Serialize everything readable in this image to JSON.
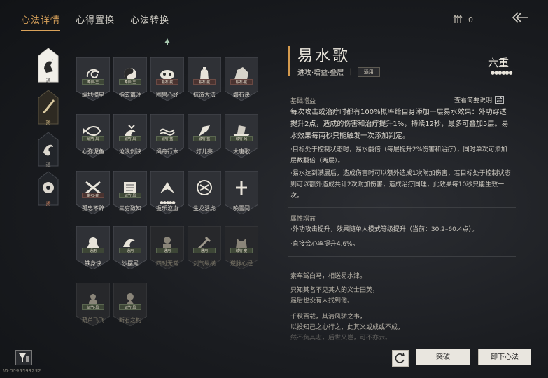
{
  "tabs": [
    {
      "label": "心法详情",
      "active": true
    },
    {
      "label": "心得置换",
      "active": false
    },
    {
      "label": "心法转换",
      "active": false
    }
  ],
  "currency": {
    "value": "0",
    "icon": "arrows-icon"
  },
  "categories": [
    {
      "label": "通",
      "icon": "horse-icon",
      "selected": true
    },
    {
      "label": "扬",
      "icon": "quill-icon"
    },
    {
      "label": "通",
      "icon": "dragon-icon"
    },
    {
      "label": "扬",
      "icon": "wheel-icon"
    }
  ],
  "cards": [
    {
      "name": "纵地摘星",
      "tag": "奉辰·王",
      "tag_style": "green",
      "icon": "swirl-icon"
    },
    {
      "name": "指玄篇注",
      "tag": "奉辰·王",
      "tag_style": "green",
      "icon": "yinyang-icon"
    },
    {
      "name": "困兽心经",
      "tag": "毅石·疵",
      "tag_style": "red",
      "icon": "beast-icon"
    },
    {
      "name": "抗造大法",
      "tag": "毅石·疵",
      "tag_style": "red",
      "icon": "bell-icon"
    },
    {
      "name": "磐石诀",
      "tag": "毅石·疵",
      "tag_style": "red",
      "icon": "rock-icon"
    },
    {
      "name": "心弥泥鱼",
      "tag": "城竹·风",
      "tag_style": "green",
      "icon": "fish-icon"
    },
    {
      "name": "沧浪剑诀",
      "tag": "城竹·风",
      "tag_style": "green",
      "icon": "dragon-icon"
    },
    {
      "name": "绳舟行木",
      "tag": "城竹·蓝",
      "tag_style": "green",
      "icon": "tentacle-icon"
    },
    {
      "name": "灯儿亮",
      "tag": "城竹·蓝",
      "tag_style": "green",
      "icon": "lamp-icon"
    },
    {
      "name": "大唐歌",
      "tag": "城竹·风",
      "tag_style": "green",
      "icon": "ship-icon"
    },
    {
      "name": "孤忠不辞",
      "tag": "毅石·疵",
      "tag_style": "red",
      "icon": "swords-icon"
    },
    {
      "name": "三穷致知",
      "tag": "城竹·风",
      "tag_style": "green",
      "icon": "scroll-icon"
    },
    {
      "name": "扳乐泣血",
      "tag": "",
      "tag_style": "none",
      "icon": "blade-icon",
      "dots": "●●●●●"
    },
    {
      "name": "生龙活虎",
      "tag": "",
      "tag_style": "none",
      "icon": "tiger-icon"
    },
    {
      "name": "晚雪间",
      "tag": "",
      "tag_style": "none",
      "icon": "cross-icon"
    },
    {
      "name": "铁身诀",
      "tag": "通用",
      "tag_style": "green",
      "icon": "fist-icon"
    },
    {
      "name": "沙摆尾",
      "tag": "通用",
      "tag_style": "green",
      "icon": "wave-icon"
    },
    {
      "name": "四时无常",
      "tag": "通用",
      "tag_style": "green",
      "icon": "figure-icon",
      "dim": true
    },
    {
      "name": "剑气纵横",
      "tag": "通用",
      "tag_style": "green",
      "icon": "sword-icon",
      "dim": true
    },
    {
      "name": "逆脉心经",
      "tag": "城竹·皮",
      "tag_style": "green",
      "icon": "wolf-icon",
      "dim": true
    },
    {
      "name": "葫芦飞飞",
      "tag": "城竹·风",
      "tag_style": "green",
      "icon": "gourd-icon",
      "dim": true
    },
    {
      "name": "断石之构",
      "tag": "城竹·风",
      "tag_style": "green",
      "icon": "monk-icon",
      "dim": true
    }
  ],
  "detail": {
    "title": "易水歌",
    "subtitle": "进攻·增益·叠层",
    "badge": "通用",
    "level": "六重",
    "level_dots": "●●●●●●",
    "section_basic": "基础增益",
    "brief_toggle": "查看简要说明",
    "basic_p1": "每次攻击或治疗时都有100%概率给自身添加一层易水效果：外功穿透提升2点，造成的伤害和治疗提升1%，持续12秒，最多可叠加5层。易水效果每两秒只能触发一次添加判定。",
    "basic_p2": "·目标处于控制状态时，易水翻倍（每层提升2%伤害和治疗），同时单次可添加层数翻倍（两层）。",
    "basic_p3": "·易水达到满层后，造成伤害时可以额外造成1次附加伤害，若目标处于控制状态则可以额外造成共计2次附加伤害，造成治疗同理，此效果每10秒只能生效一次。",
    "section_attr": "属性增益",
    "attr_p1": "·外功攻击提升，效果随单人模式等级提升（当前：30.2–60.4点）。",
    "attr_p2": "·直接会心率提升4.6%。",
    "poem": [
      "素车驾白马，相送易水津。",
      "只知其名不见其人的义士田英，",
      "最后也没有人找到他。",
      "千秋百载，其清风骄之事，",
      "以投知己之心行之，此其义或成或不成，",
      "然不负其志，后世又岂，可不亦云。"
    ]
  },
  "bottom": {
    "id_text": "ID:0095593252",
    "break_label": "突破",
    "unload_label": "卸下心法"
  }
}
